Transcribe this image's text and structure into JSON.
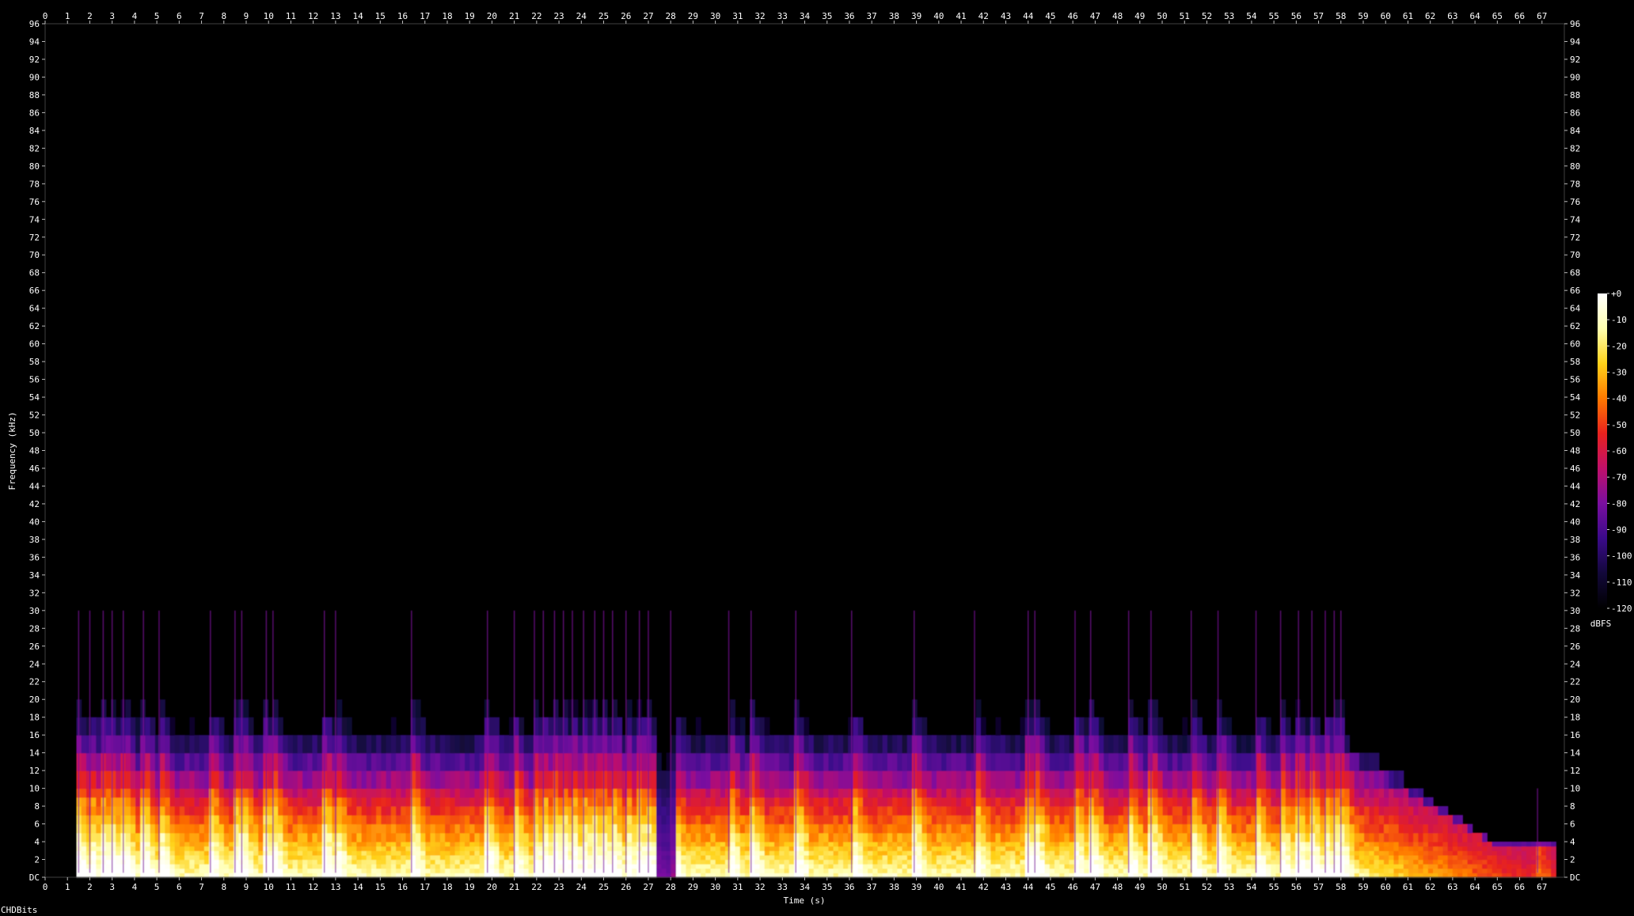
{
  "chart_data": {
    "type": "heatmap",
    "xlabel": "Time (s)",
    "ylabel": "Frequency (kHz)",
    "xlim": [
      0,
      68
    ],
    "ylim": [
      0,
      96
    ],
    "x_ticks": [
      0,
      1,
      2,
      3,
      4,
      5,
      6,
      7,
      8,
      9,
      10,
      11,
      12,
      13,
      14,
      15,
      16,
      17,
      18,
      19,
      20,
      21,
      22,
      23,
      24,
      25,
      26,
      27,
      28,
      29,
      30,
      31,
      32,
      33,
      34,
      35,
      36,
      37,
      38,
      39,
      40,
      41,
      42,
      43,
      44,
      45,
      46,
      47,
      48,
      49,
      50,
      51,
      52,
      53,
      54,
      55,
      56,
      57,
      58,
      59,
      60,
      61,
      62,
      63,
      64,
      65,
      66,
      67
    ],
    "y_ticks": [
      "DC",
      "2",
      "4",
      "6",
      "8",
      "10",
      "12",
      "14",
      "16",
      "18",
      "20",
      "22",
      "24",
      "26",
      "28",
      "30",
      "32",
      "34",
      "36",
      "38",
      "40",
      "42",
      "44",
      "46",
      "48",
      "50",
      "52",
      "54",
      "56",
      "58",
      "60",
      "62",
      "64",
      "66",
      "68",
      "70",
      "72",
      "74",
      "76",
      "78",
      "80",
      "82",
      "84",
      "86",
      "88",
      "90",
      "92",
      "94",
      "96"
    ],
    "colorbar": {
      "label": "dBFS",
      "range": [
        -120,
        0
      ],
      "ticks": [
        "+0",
        "-10",
        "-20",
        "-30",
        "-40",
        "-50",
        "-60",
        "-70",
        "-80",
        "-90",
        "-100",
        "-110",
        "-120"
      ],
      "colors": [
        "#000000",
        "#12083a",
        "#3b0a8a",
        "#7a0fa0",
        "#c0106a",
        "#e8221e",
        "#ff7a00",
        "#ffd21a",
        "#ffffb0",
        "#ffffff"
      ]
    },
    "signal": {
      "start_s": 1.4,
      "end_s": 67.6,
      "fade_start_s": 58,
      "max_content_khz": 34,
      "gaps_s": [
        27.3,
        28.1
      ],
      "transients_s": [
        1.5,
        2.0,
        2.6,
        3.0,
        3.5,
        4.4,
        5.1,
        7.4,
        8.5,
        8.8,
        9.9,
        10.2,
        12.5,
        13.0,
        16.4,
        19.8,
        21.0,
        21.9,
        22.3,
        22.8,
        23.2,
        23.6,
        24.1,
        24.6,
        25.0,
        25.4,
        26.0,
        26.6,
        27.0,
        28.0,
        30.6,
        31.6,
        33.6,
        36.1,
        38.9,
        41.6,
        44.0,
        44.3,
        46.1,
        46.8,
        48.5,
        49.5,
        51.3,
        52.5,
        54.2,
        55.3,
        56.1,
        56.7,
        57.3,
        57.7,
        58.0,
        66.8
      ]
    },
    "footer_text": "CHDBits"
  }
}
